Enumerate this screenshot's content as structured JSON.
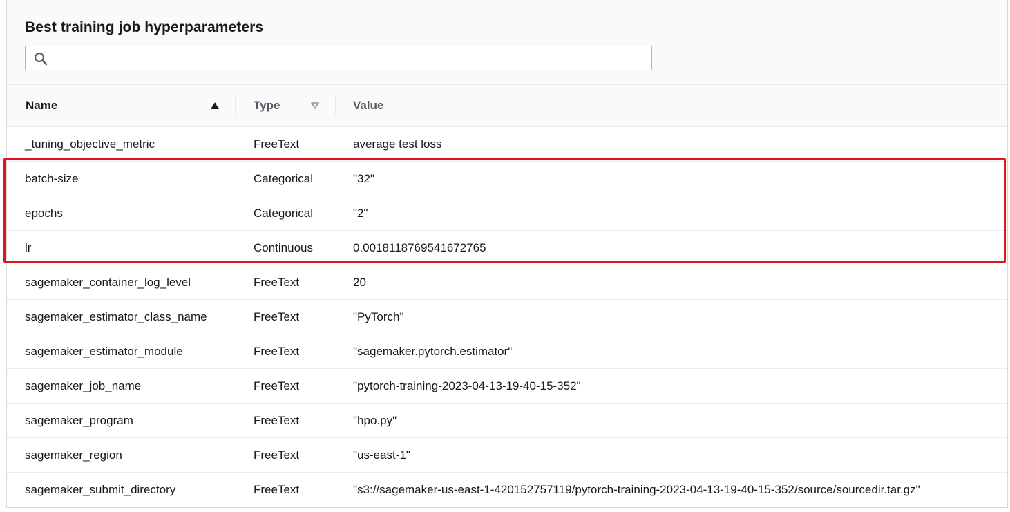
{
  "panel": {
    "title": "Best training job hyperparameters",
    "search": {
      "value": "",
      "placeholder": ""
    }
  },
  "table": {
    "columns": [
      {
        "label": "Name",
        "sort": "ascending"
      },
      {
        "label": "Type",
        "sort": "none"
      },
      {
        "label": "Value",
        "sort": null
      }
    ],
    "rows": [
      {
        "name": "_tuning_objective_metric",
        "type": "FreeText",
        "value": "average test loss"
      },
      {
        "name": "batch-size",
        "type": "Categorical",
        "value": "\"32\""
      },
      {
        "name": "epochs",
        "type": "Categorical",
        "value": "\"2\""
      },
      {
        "name": "lr",
        "type": "Continuous",
        "value": "0.0018118769541672765"
      },
      {
        "name": "sagemaker_container_log_level",
        "type": "FreeText",
        "value": "20"
      },
      {
        "name": "sagemaker_estimator_class_name",
        "type": "FreeText",
        "value": "\"PyTorch\""
      },
      {
        "name": "sagemaker_estimator_module",
        "type": "FreeText",
        "value": "\"sagemaker.pytorch.estimator\""
      },
      {
        "name": "sagemaker_job_name",
        "type": "FreeText",
        "value": "\"pytorch-training-2023-04-13-19-40-15-352\""
      },
      {
        "name": "sagemaker_program",
        "type": "FreeText",
        "value": "\"hpo.py\""
      },
      {
        "name": "sagemaker_region",
        "type": "FreeText",
        "value": "\"us-east-1\""
      },
      {
        "name": "sagemaker_submit_directory",
        "type": "FreeText",
        "value": "\"s3://sagemaker-us-east-1-420152757119/pytorch-training-2023-04-13-19-40-15-352/source/sourcedir.tar.gz\""
      }
    ]
  },
  "annotation": {
    "highlight_color": "#e0161f",
    "highlighted_rows": [
      "batch-size",
      "epochs",
      "lr"
    ]
  },
  "colors": {
    "header_bg": "#fafafa",
    "border": "#eaeded",
    "text": "#16191f",
    "muted_header": "#545b64"
  }
}
